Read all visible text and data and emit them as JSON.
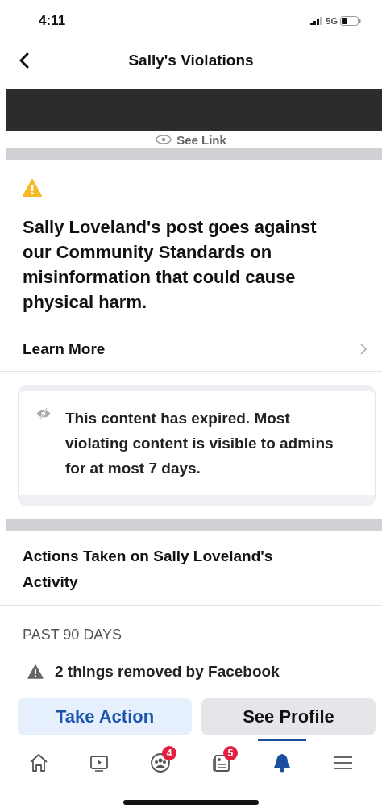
{
  "status_bar": {
    "time": "4:11",
    "network": "5G"
  },
  "header": {
    "title": "Sally's Violations"
  },
  "see_link": {
    "label": "See Link"
  },
  "violation": {
    "headline": "Sally Loveland's post goes against our Community Standards on misinformation that could cause physical harm.",
    "learn_more": "Learn More"
  },
  "notice": {
    "text": "This content has expired. Most violating content is visible to admins for at most 7 days."
  },
  "actions": {
    "heading": "Actions Taken on Sally Loveland's Activity",
    "period": "PAST 90 DAYS",
    "items": [
      "2 things removed by Facebook"
    ]
  },
  "buttons": [
    {
      "label": "Take Action",
      "kind": "primary"
    },
    {
      "label": "See Profile",
      "kind": "secondary"
    }
  ],
  "tabs": [
    {
      "kind": "home",
      "selected": false
    },
    {
      "kind": "video",
      "selected": false
    },
    {
      "kind": "groups",
      "selected": false,
      "badge": "4"
    },
    {
      "kind": "news",
      "selected": false,
      "badge": "5"
    },
    {
      "kind": "bell",
      "selected": true
    },
    {
      "kind": "menu",
      "selected": false
    }
  ]
}
